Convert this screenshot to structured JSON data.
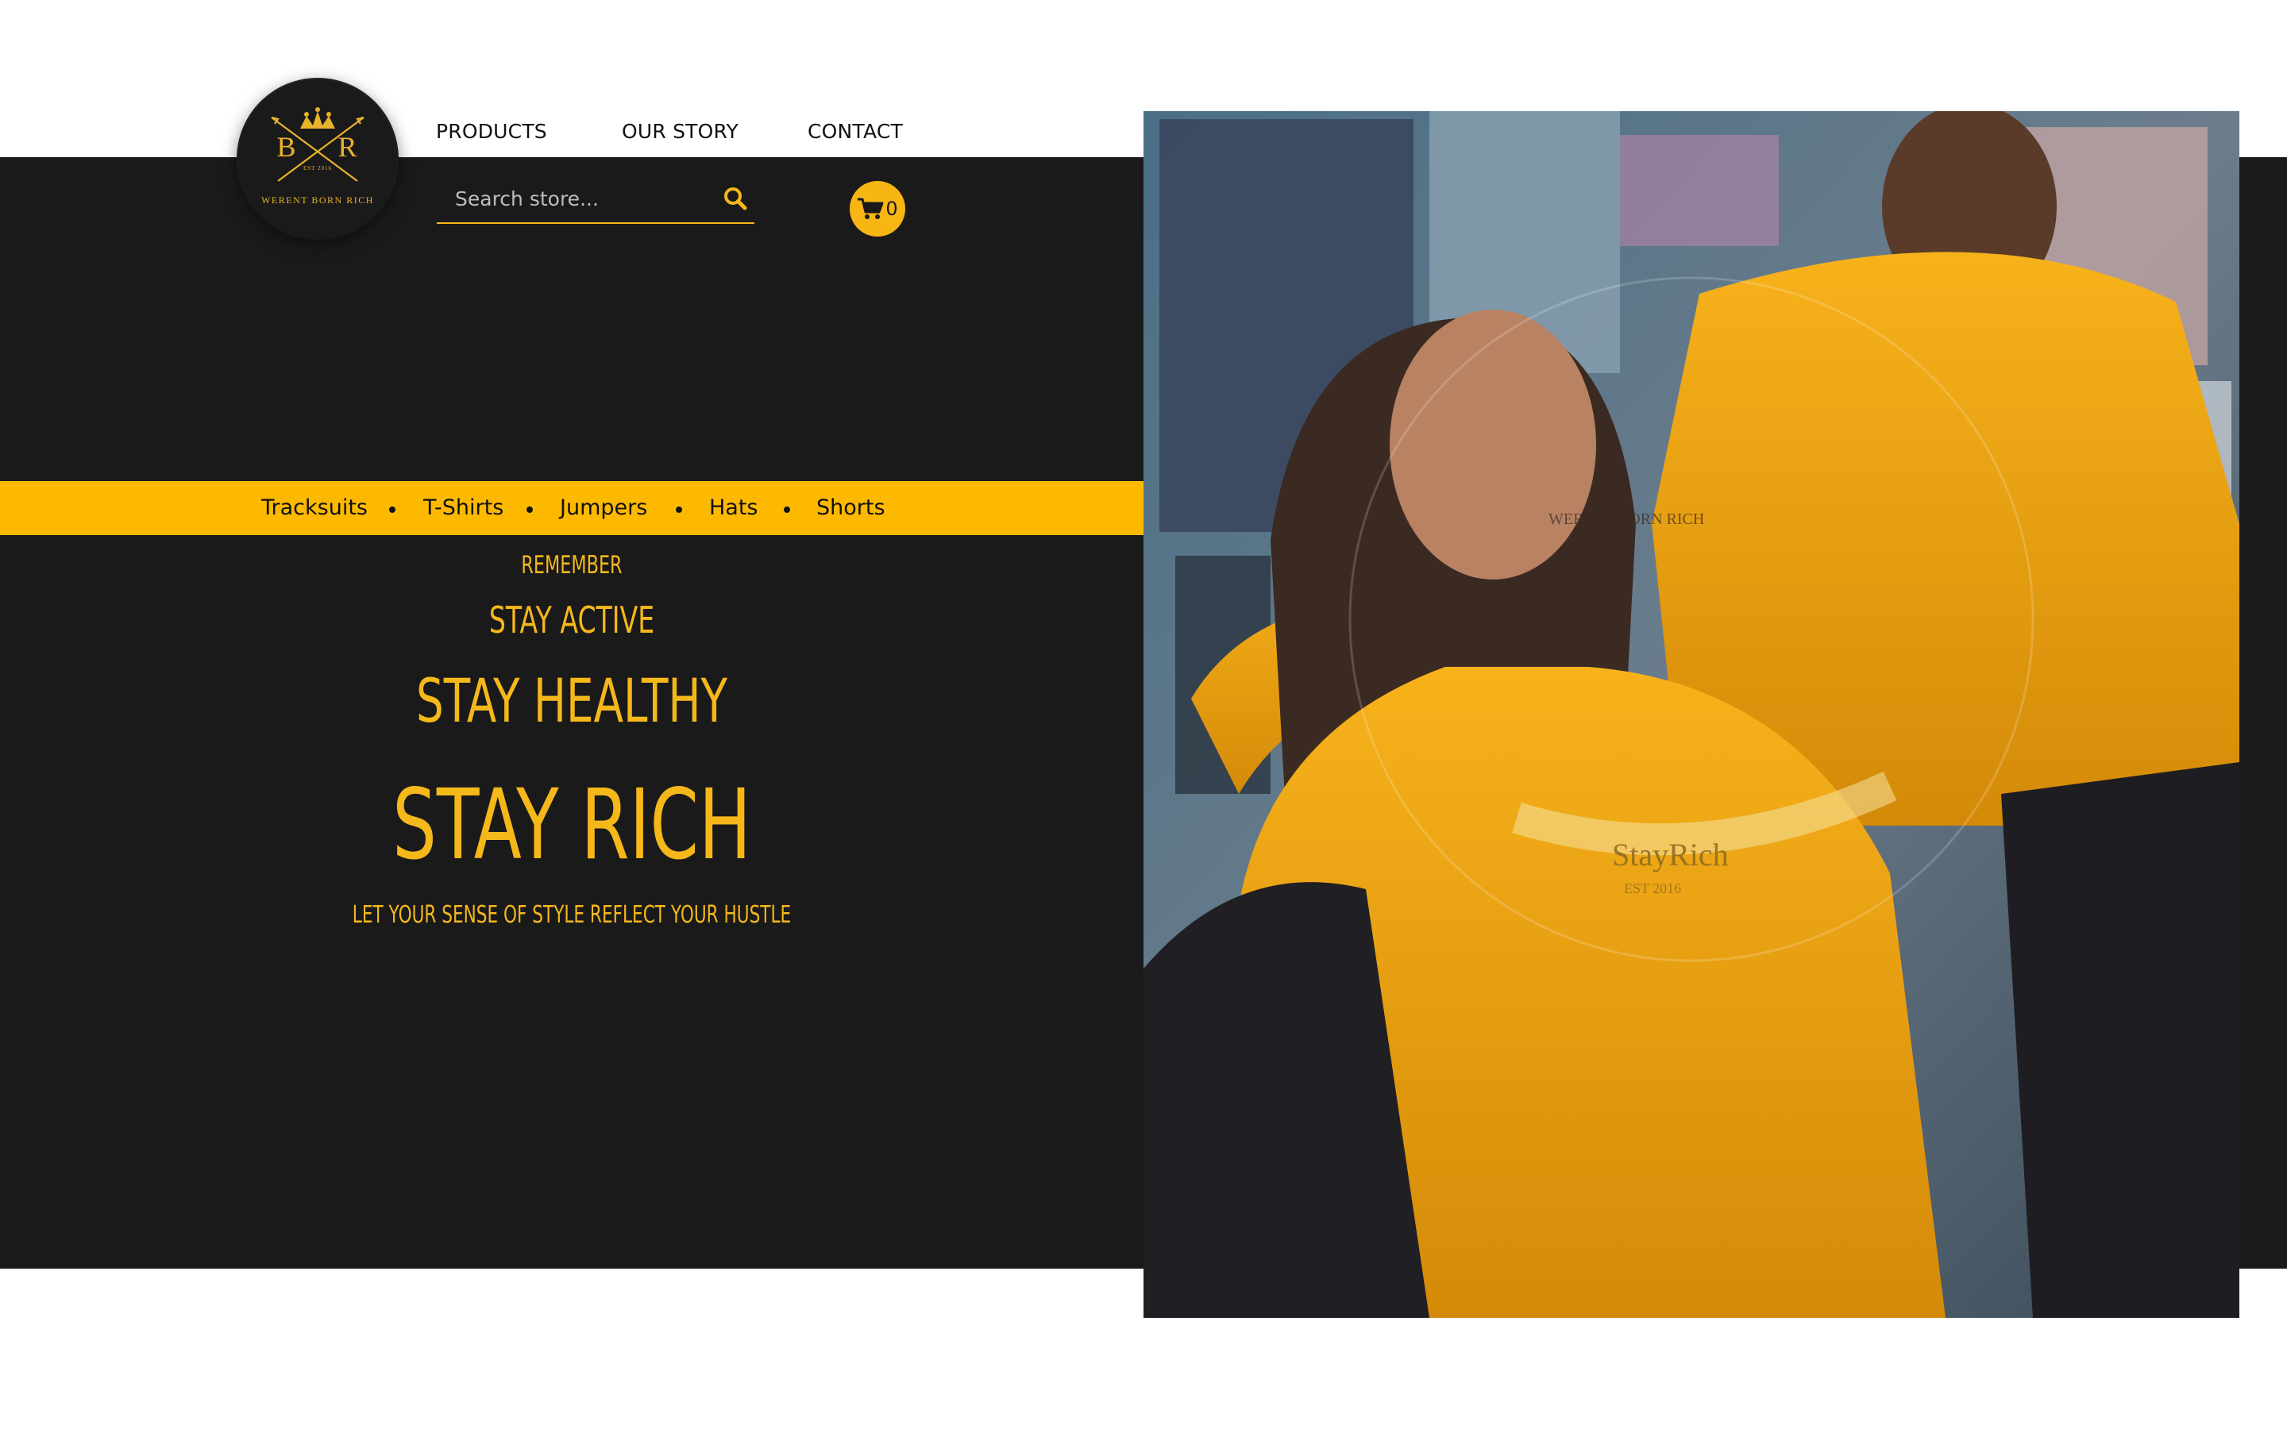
{
  "brand": {
    "logo_letters": "B R",
    "logo_tagline": "WERENT BORN RICH",
    "logo_est": "EST 2016"
  },
  "nav": {
    "products": "PRODUCTS",
    "our_story": "OUR STORY",
    "contact": "CONTACT"
  },
  "search": {
    "placeholder": "Search store..."
  },
  "cart": {
    "count": "0"
  },
  "categories": [
    "Tracksuits",
    "T-Shirts",
    "Jumpers",
    "Hats",
    "Shorts"
  ],
  "hero": {
    "remember": "REMEMBER",
    "stay_active": "STAY ACTIVE",
    "stay_healthy": "STAY HEALTHY",
    "stay_rich": "STAY RICH",
    "tagline": "LET YOUR SENSE OF STYLE REFLECT YOUR HUSTLE"
  },
  "photo": {
    "print_text": "StayRich",
    "print_est": "EST 2016",
    "badge_text": "WERENT BORN RICH"
  },
  "colors": {
    "accent": "#fdb900",
    "dark": "#1b1a1b",
    "background": "#ffffff"
  }
}
